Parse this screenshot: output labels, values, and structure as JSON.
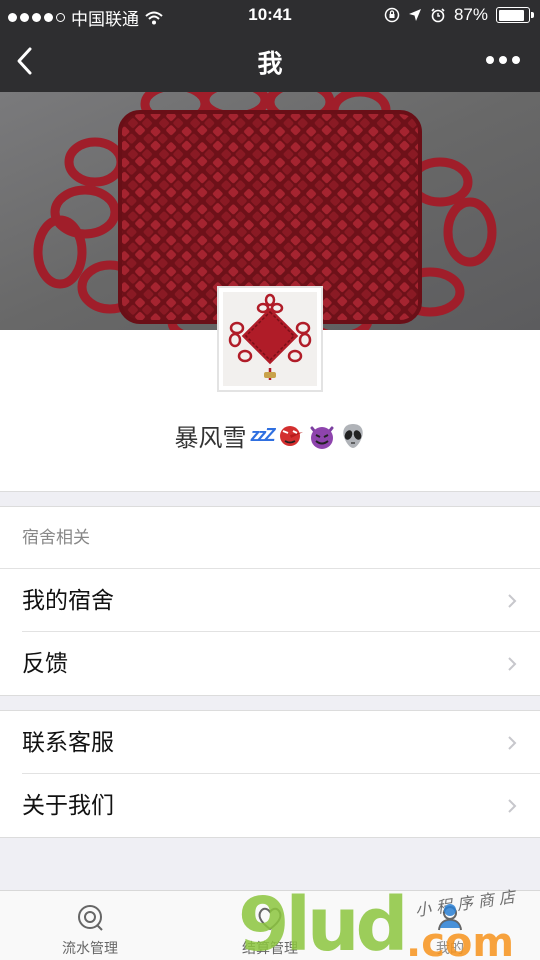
{
  "status_bar": {
    "carrier": "中国联通",
    "time": "10:41",
    "battery": "87%",
    "battery_level": 0.87
  },
  "nav": {
    "title": "我",
    "back_icon": "chevron-left-icon",
    "more_icon": "more-dots-icon"
  },
  "profile": {
    "username": "暴风雪",
    "emoji_zzz": "zzZ",
    "emojis": [
      "tengu-mask",
      "purple-devil",
      "alien"
    ]
  },
  "section_dorm": {
    "header": "宿舍相关",
    "items": [
      {
        "label": "我的宿舍"
      },
      {
        "label": "反馈"
      }
    ]
  },
  "section_other": {
    "items": [
      {
        "label": "联系客服"
      },
      {
        "label": "关于我们"
      }
    ]
  },
  "tab_bar": {
    "tabs": [
      {
        "label": "流水管理",
        "icon": "chat-bubble-icon"
      },
      {
        "label": "结算管理",
        "icon": "heart-icon"
      },
      {
        "label": "我的",
        "icon": "person-icon"
      }
    ]
  },
  "watermark": {
    "text": "9lud.com",
    "subtext": "小程序商店"
  },
  "colors": {
    "bar_bg": "#2e2e30",
    "knot_red": "#8e1a22",
    "watermark_green": "#8cc63f",
    "watermark_orange": "#f7941d"
  }
}
